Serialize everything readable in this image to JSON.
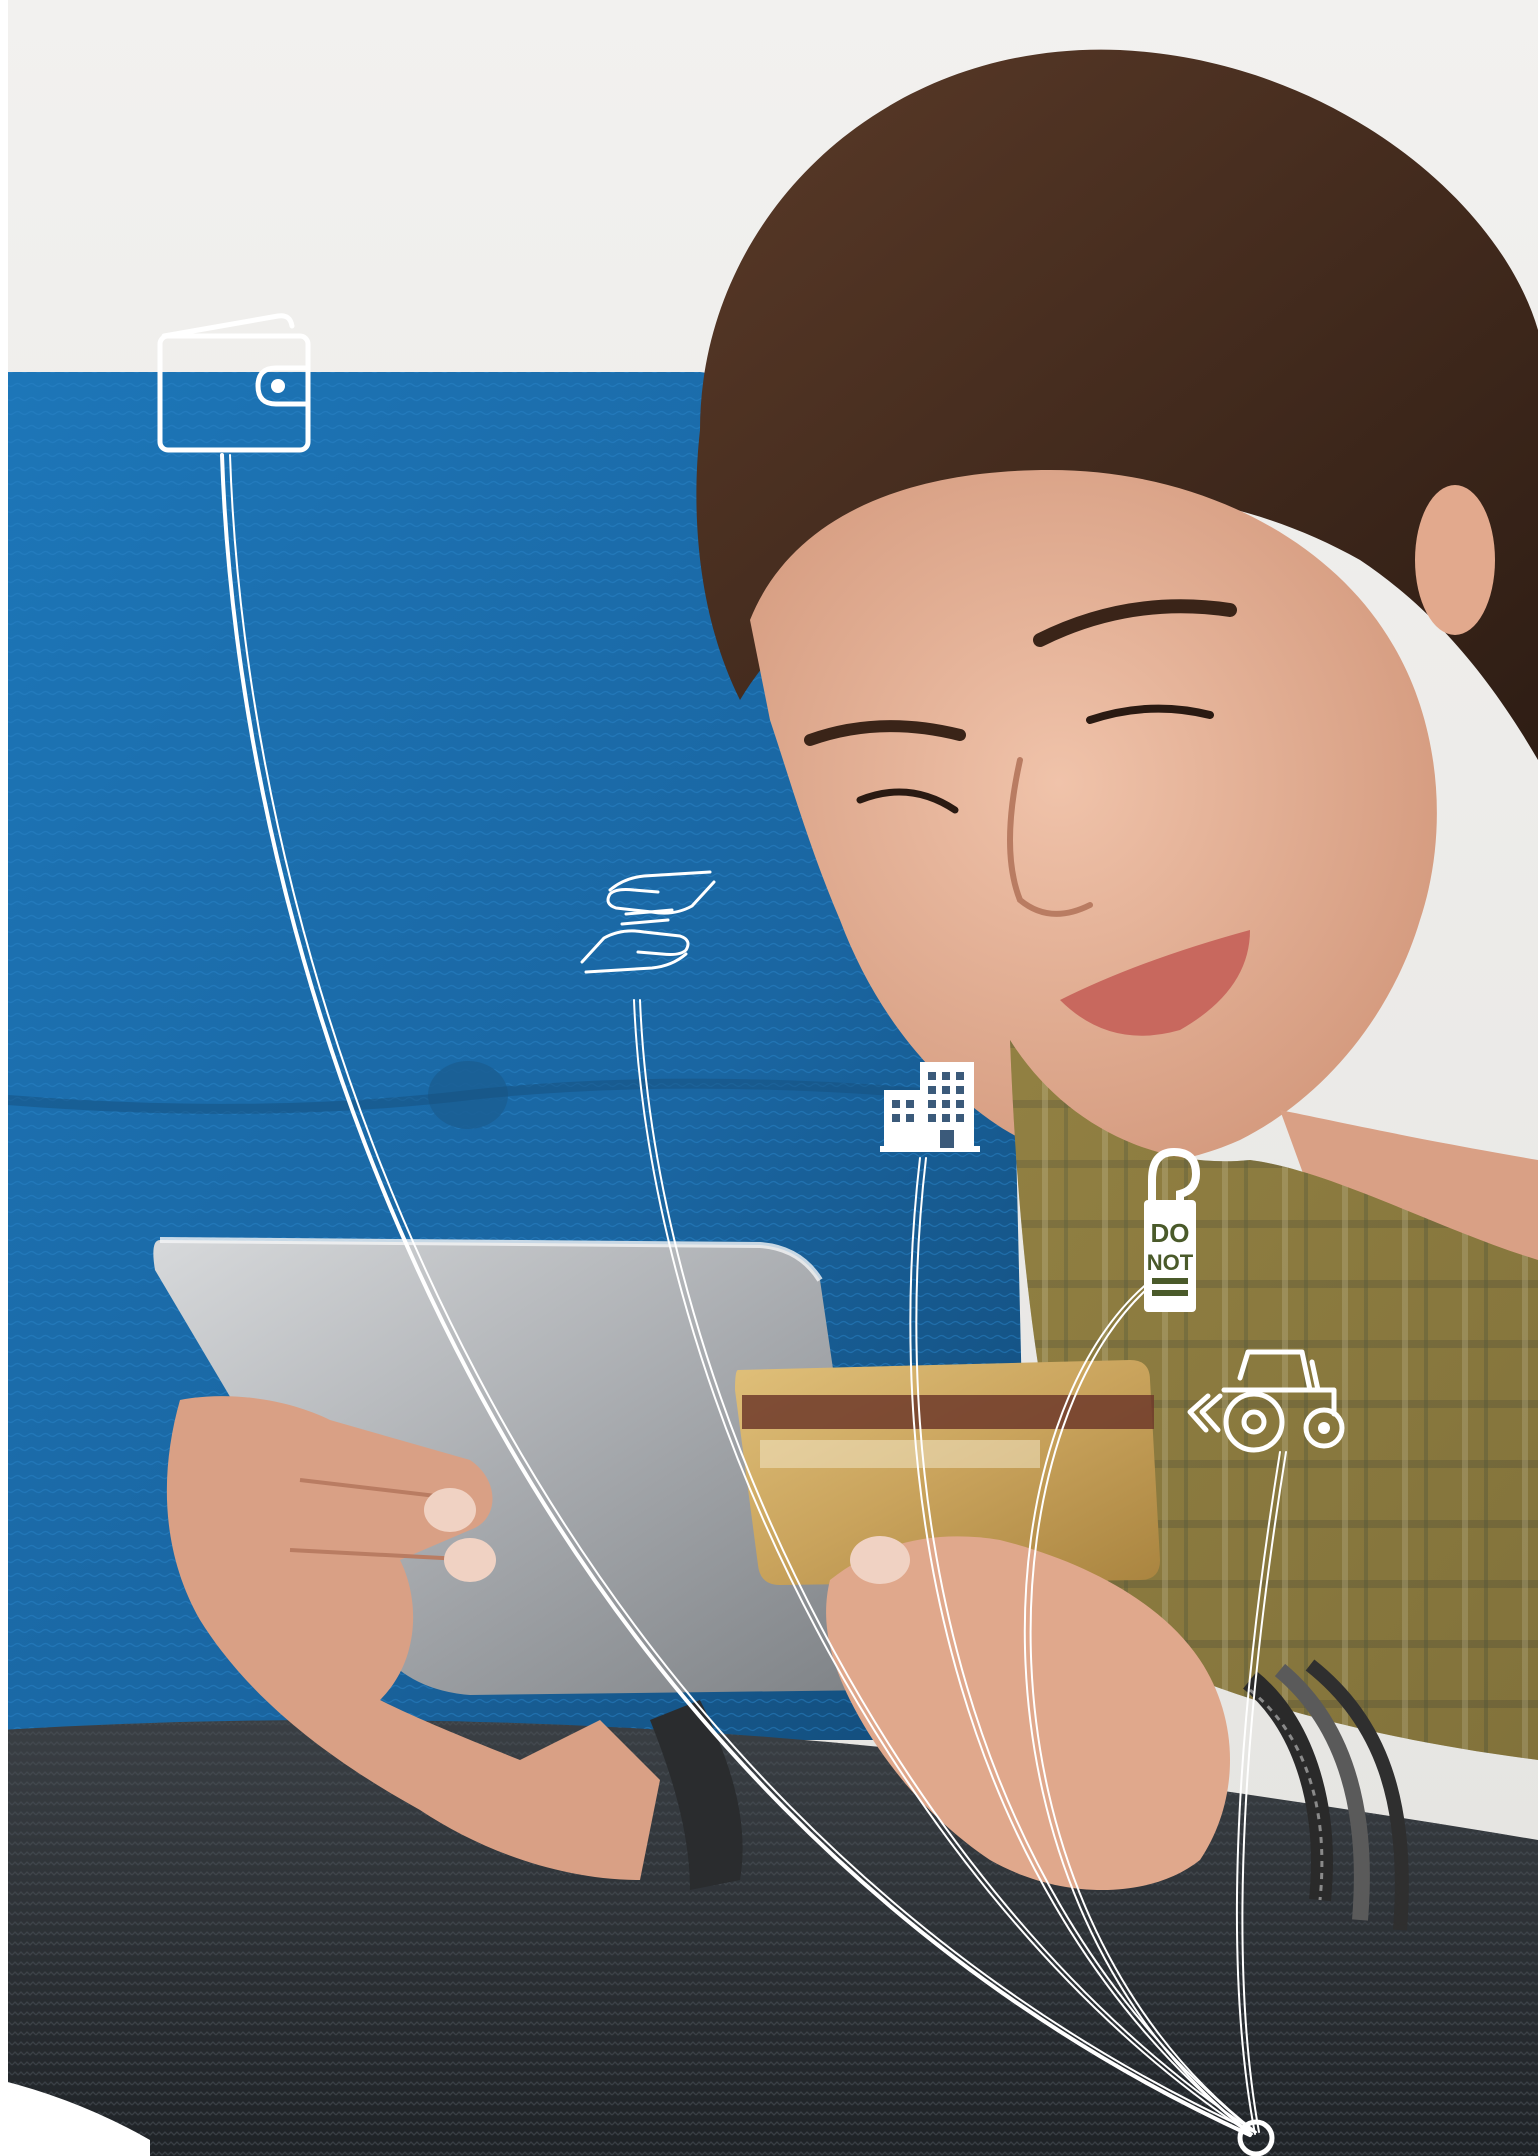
{
  "scene": {
    "colors": {
      "wall": "#ecebe8",
      "sofa_blue": "#1f6fae",
      "sofa_blue_dark": "#15507f",
      "cushion_dark": "#2b3034",
      "skin": "#e6b39b",
      "hair": "#4a2f22",
      "shirt": "#8c7a3e",
      "tablet": "#b9bcbf",
      "card_gold": "#c8a45a",
      "line": "#ffffff"
    },
    "icons": [
      {
        "name": "wallet-icon"
      },
      {
        "name": "handshake-hands-icon"
      },
      {
        "name": "office-building-icon"
      },
      {
        "name": "door-hanger-icon"
      },
      {
        "name": "tractor-icon"
      }
    ],
    "door_hanger_text": {
      "line1": "DO",
      "line2": "NOT"
    }
  }
}
